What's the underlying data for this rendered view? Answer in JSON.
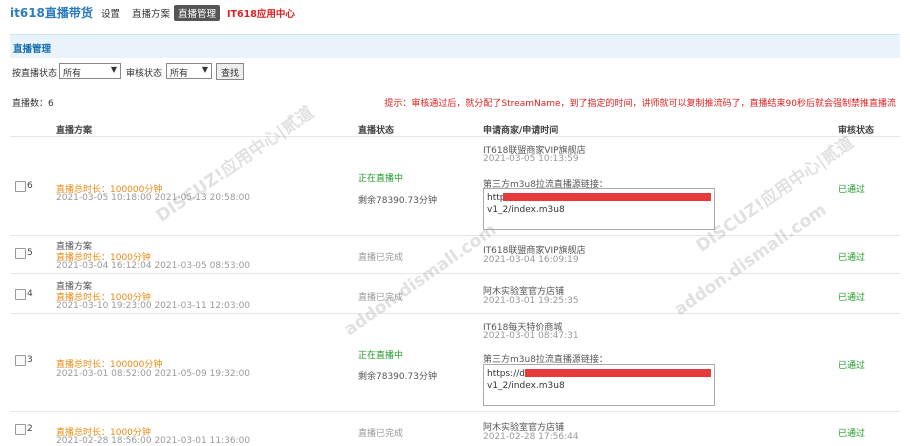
{
  "topnav": {
    "brand": "it618直播带货",
    "items": [
      "设置",
      "直播方案",
      "直播管理",
      "IT618应用中心"
    ]
  },
  "section": {
    "title": "直播管理"
  },
  "filters": {
    "live_status_label": "按直播状态",
    "live_status_value": "所有",
    "audit_status_label": "审核状态",
    "audit_status_value": "所有",
    "search_button": "查找"
  },
  "summary": {
    "count": "直播数：6",
    "notice": "提示：审核通过后，就分配了StreamName，到了指定的时间，讲师就可以复制推流码了，直播结束90秒后就会强制禁推直播流"
  },
  "table": {
    "headers": [
      "直播方案",
      "直播状态",
      "申请商家/申请时间",
      "审核状态"
    ],
    "link_label": "第三方m3u8拉流直播源链接：",
    "rows": [
      {
        "id": "6",
        "plan": "",
        "duration": "直播总时长：100000分钟",
        "period": "2021-03-05 10:18:00 2021-05-13 20:58:00",
        "status": "正在直播中",
        "remaining": "剩余78390.73分钟",
        "merchant": "IT618联盟商家VIP旗舰店",
        "apply_time": "2021-03-05 10:13:59",
        "link_l1": "http",
        "link_l2": "v1_2/index.m3u8",
        "audit": "已通过"
      },
      {
        "id": "5",
        "plan": "直播方案",
        "duration": "直播总时长：1000分钟",
        "period": "2021-03-04 16:12:04 2021-03-05 08:53:00",
        "status": "直播已完成",
        "merchant": "IT618联盟商家VIP旗舰店",
        "apply_time": "2021-03-04 16:09:19",
        "audit": "已通过"
      },
      {
        "id": "4",
        "plan": "直播方案",
        "duration": "直播总时长：1000分钟",
        "period": "2021-03-10 19:23:00 2021-03-11 12:03:00",
        "status": "直播已完成",
        "merchant": "阿木实验室官方店铺",
        "apply_time": "2021-03-01 19:25:35",
        "audit": "已通过"
      },
      {
        "id": "3",
        "plan": "",
        "duration": "直播总时长：100000分钟",
        "period": "2021-03-01 08:52:00 2021-05-09 19:32:00",
        "status": "正在直播中",
        "remaining": "剩余78390.73分钟",
        "merchant": "IT618每天特价商城",
        "apply_time": "2021-03-01 08:47:31",
        "link_l1": "https://d",
        "link_l2": "v1_2/index.m3u8",
        "audit": "已通过"
      },
      {
        "id": "2",
        "plan": "",
        "duration": "直播总时长：1000分钟",
        "period": "2021-02-28 18:56:00 2021-03-01 11:36:00",
        "status": "直播已完成",
        "merchant": "阿木实验室官方店铺",
        "apply_time": "2021-02-28 17:56:44",
        "audit": "已通过"
      }
    ]
  },
  "watermark": {
    "line1": "DISCUZ!应用中心|贰道",
    "line2": "addon.dismall.com"
  }
}
